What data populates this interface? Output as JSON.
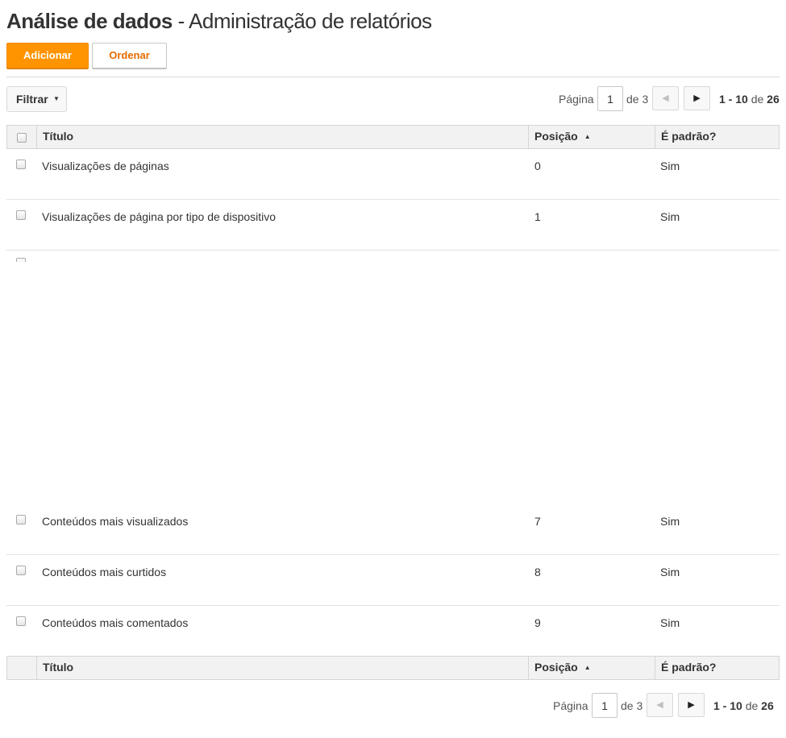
{
  "header": {
    "title_strong": "Análise de dados",
    "title_rest": " - Administração de relatórios"
  },
  "toolbar": {
    "add_label": "Adicionar",
    "order_label": "Ordenar"
  },
  "filter": {
    "label": "Filtrar"
  },
  "pagination": {
    "page_label": "Página",
    "current_page": "1",
    "of_label": "de 3",
    "range": "1 - 10",
    "range_of": "de",
    "total": "26"
  },
  "table": {
    "columns": {
      "title": "Título",
      "position": "Posição",
      "default": "É padrão?"
    },
    "rows": [
      {
        "title": "Visualizações de páginas",
        "position": "0",
        "default": "Sim"
      },
      {
        "title": "Visualizações de página por tipo de dispositivo",
        "position": "1",
        "default": "Sim"
      },
      {
        "title": "Conteúdos mais visualizados",
        "position": "7",
        "default": "Sim"
      },
      {
        "title": "Conteúdos mais curtidos",
        "position": "8",
        "default": "Sim"
      },
      {
        "title": "Conteúdos mais comentados",
        "position": "9",
        "default": "Sim"
      }
    ]
  },
  "colors": {
    "primary_button": "#ff9400",
    "secondary_button_text": "#e56b00",
    "header_bg": "#f2f2f2"
  },
  "icons": {
    "filter_caret": "caret-down-icon",
    "sort": "sort-ascending-icon",
    "prev": "chevron-left-icon",
    "next": "chevron-right-icon"
  }
}
